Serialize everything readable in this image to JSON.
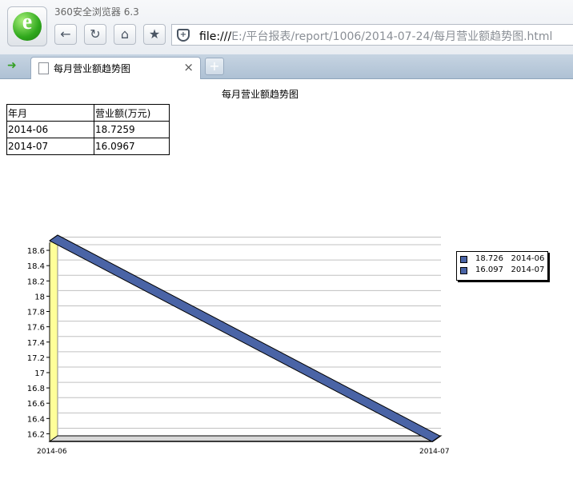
{
  "browser": {
    "app_name": "360安全浏览器 6.3",
    "logo_letter": "e",
    "address": {
      "prefix": "file:///",
      "path": "E:/平台报表/report/1006/2014-07-24/每月营业额趋势图.html"
    },
    "nav_icons": [
      "back-arrow-icon",
      "refresh-icon",
      "home-icon",
      "star-icon"
    ],
    "tab": {
      "title": "每月营业额趋势图",
      "close_glyph": "×"
    },
    "new_tab_glyph": "+"
  },
  "page": {
    "title": "每月营业额趋势图",
    "table": {
      "headers": [
        "年月",
        "营业额(万元)"
      ],
      "rows": [
        [
          "2014-06",
          "18.7259"
        ],
        [
          "2014-07",
          "16.0967"
        ]
      ]
    }
  },
  "chart_data": {
    "type": "line",
    "title": "",
    "xlabel": "",
    "ylabel": "",
    "categories": [
      "2014-06",
      "2014-07"
    ],
    "series": [
      {
        "values": [
          18.726,
          16.097
        ],
        "color": "#4a64a6"
      }
    ],
    "ylim": [
      16.1,
      18.7
    ],
    "yticks": [
      18.6,
      18.4,
      18.2,
      18,
      17.8,
      17.6,
      17.4,
      17.2,
      17,
      16.8,
      16.6,
      16.4,
      16.2
    ],
    "grid": true,
    "wall_color": "#ffff99",
    "legend": {
      "placement": "right",
      "entries": [
        {
          "value": "18.726",
          "label": "2014-06",
          "color": "#4a64a6"
        },
        {
          "value": "16.097",
          "label": "2014-07",
          "color": "#4a64a6"
        }
      ]
    }
  }
}
